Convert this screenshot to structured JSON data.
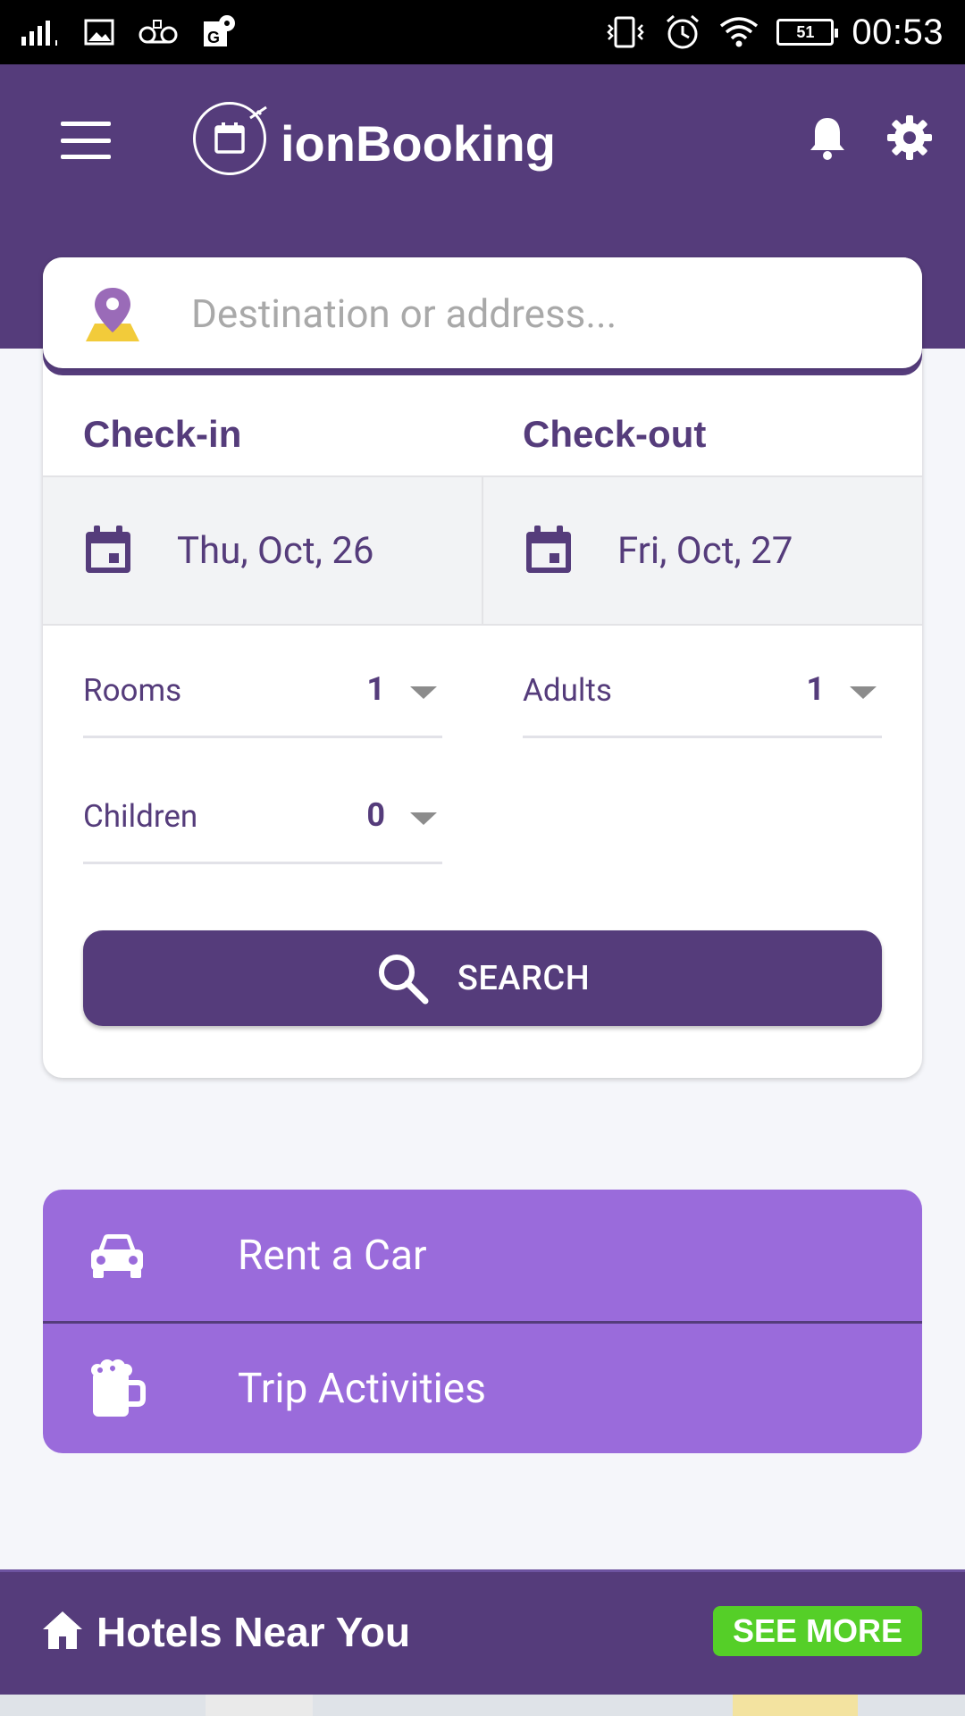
{
  "status_bar": {
    "time": "00:53",
    "battery": "51"
  },
  "header": {
    "app_title": "ionBooking"
  },
  "search": {
    "placeholder": "Destination or address..."
  },
  "dates": {
    "checkin_label": "Check-in",
    "checkout_label": "Check-out",
    "checkin_value": "Thu, Oct, 26",
    "checkout_value": "Fri, Oct, 27"
  },
  "guests": {
    "rooms_label": "Rooms",
    "rooms_value": "1",
    "adults_label": "Adults",
    "adults_value": "1",
    "children_label": "Children",
    "children_value": "0"
  },
  "search_button": {
    "label": "SEARCH"
  },
  "extras": [
    {
      "label": "Rent a Car",
      "icon": "car-icon"
    },
    {
      "label": "Trip Activities",
      "icon": "beer-mug-icon"
    }
  ],
  "hotels_near": {
    "title": "Hotels Near You",
    "see_more": "SEE MORE"
  },
  "colors": {
    "primary": "#553c7b",
    "accent_purple": "#9a6bdb",
    "see_more_green": "#55cf28",
    "pin_yellow": "#f2cb3a"
  }
}
